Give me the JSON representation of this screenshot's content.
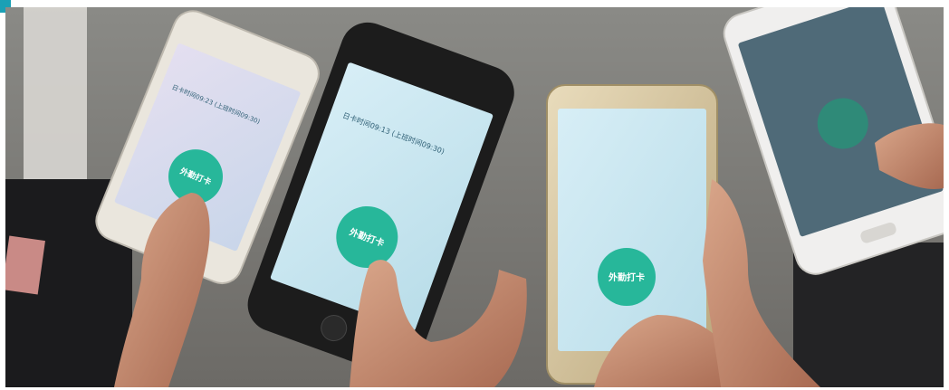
{
  "photo": {
    "accent_color": "#1aa0b5",
    "phones": [
      {
        "name": "phone-left",
        "button_label": "外勤打卡",
        "screen_text": "日卡时间09:23 (上班时间09:30)",
        "color": "#eae6dd"
      },
      {
        "name": "phone-center",
        "button_label": "外勤打卡",
        "screen_text": "日卡时间09:13 (上班时间09:30)",
        "color": "#1c1c1c"
      },
      {
        "name": "phone-right-gold",
        "button_label": "外勤打卡",
        "screen_text": "",
        "color": "#d8c9a4"
      },
      {
        "name": "phone-far-right",
        "button_label": "",
        "screen_text": "",
        "color": "#f0efee"
      }
    ],
    "button_color": "#27b79a"
  }
}
